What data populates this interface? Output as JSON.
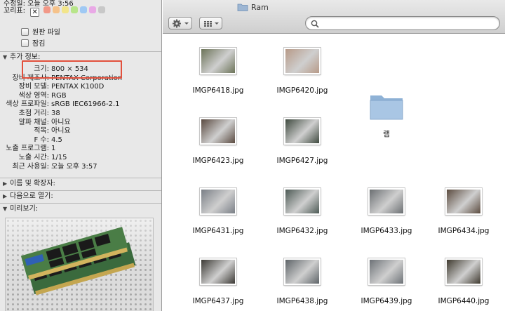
{
  "info_panel": {
    "top_cut_text": "수정일: 오늘 오후 3:56",
    "label_heading": "꼬리표:",
    "label_none": "✕",
    "label_colors": [
      "#f19887",
      "#f5c28a",
      "#f2e58a",
      "#b8e58a",
      "#9fc9f4",
      "#e9a9e6",
      "#c8c8c8"
    ],
    "stationery_pad": "원판 파일",
    "locked": "잠김",
    "more_info_heading": "추가 정보:",
    "more_info_rows": [
      {
        "key": "크기:",
        "value": "800 × 534"
      },
      {
        "key": "장비 제조사:",
        "value": "PENTAX Corporation"
      },
      {
        "key": "장비 모델:",
        "value": "PENTAX K100D"
      },
      {
        "key": "색상 영역:",
        "value": "RGB"
      },
      {
        "key": "색상 프로파일:",
        "value": "sRGB IEC61966-2.1"
      },
      {
        "key": "초점 거리:",
        "value": "38"
      },
      {
        "key": "알파 채널:",
        "value": "아니요"
      },
      {
        "key": "적목:",
        "value": "아니요"
      },
      {
        "key": "F 수:",
        "value": "4.5"
      },
      {
        "key": "노출 프로그램:",
        "value": "1"
      },
      {
        "key": "노출 시간:",
        "value": "1/15"
      },
      {
        "key": "최근 사용일:",
        "value": "오늘 오후 3:57"
      }
    ],
    "name_ext_heading": "이름 및 확장자:",
    "open_with_heading": "다음으로 열기:",
    "preview_heading": "미리보기:"
  },
  "finder": {
    "title": "Ram",
    "search_placeholder": "",
    "action_icon": "gear-icon",
    "view_icon": "grid-view-icon",
    "items": [
      {
        "name": "IMGP6418.jpg",
        "kind": "image",
        "tone": "#6c7458"
      },
      {
        "name": "IMGP6420.jpg",
        "kind": "image",
        "tone": "#b79a88"
      },
      {
        "name": "램",
        "kind": "folder"
      },
      {
        "name": "IMGP6423.jpg",
        "kind": "image",
        "tone": "#5a4a40"
      },
      {
        "name": "IMGP6427.jpg",
        "kind": "image",
        "tone": "#3f4a3f"
      },
      {
        "name": "IMGP6431.jpg",
        "kind": "image",
        "tone": "#7a7f86"
      },
      {
        "name": "IMGP6432.jpg",
        "kind": "image",
        "tone": "#4d5a55"
      },
      {
        "name": "IMGP6433.jpg",
        "kind": "image",
        "tone": "#6b6f72"
      },
      {
        "name": "IMGP6434.jpg",
        "kind": "image",
        "tone": "#5b4b3f"
      },
      {
        "name": "IMGP6437.jpg",
        "kind": "image",
        "tone": "#3c3a35"
      },
      {
        "name": "IMGP6438.jpg",
        "kind": "image",
        "tone": "#5e6468"
      },
      {
        "name": "IMGP6439.jpg",
        "kind": "image",
        "tone": "#6d7277"
      },
      {
        "name": "IMGP6440.jpg",
        "kind": "image",
        "tone": "#3f3a2f"
      }
    ]
  }
}
